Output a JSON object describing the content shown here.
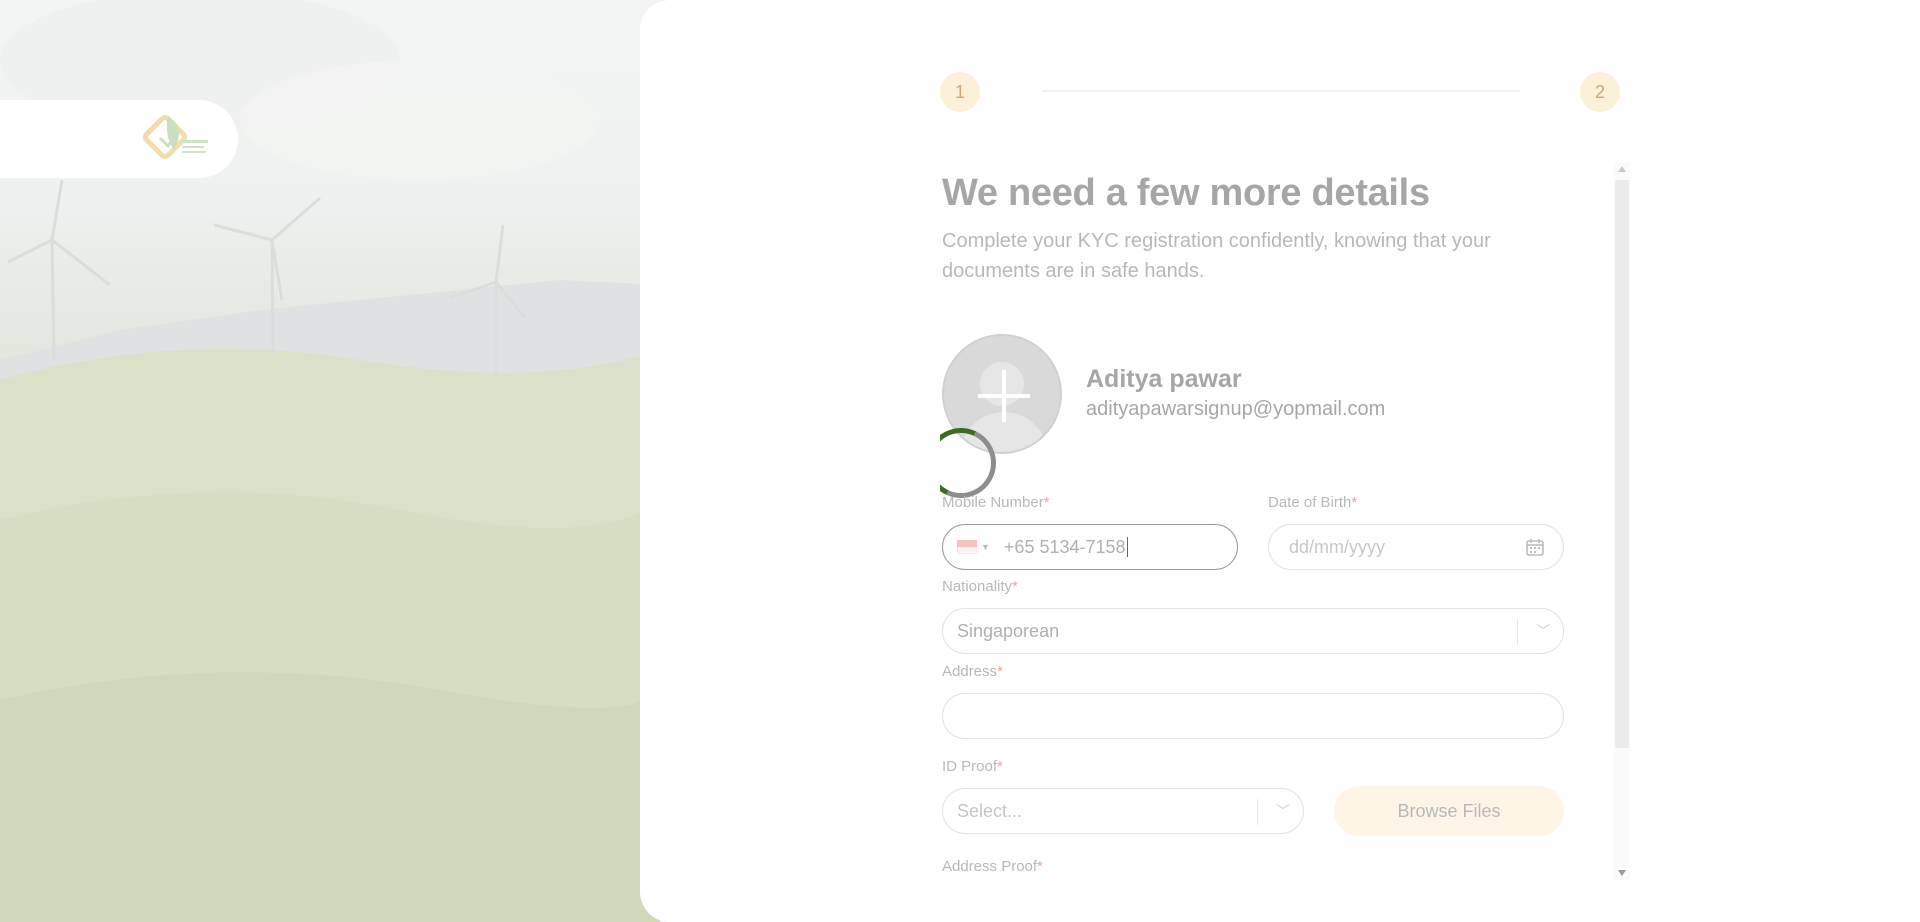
{
  "stepper": {
    "steps": [
      "1",
      "2"
    ]
  },
  "form": {
    "title": "We need a few more details",
    "subtitle": "Complete your KYC registration confidently, knowing that your documents are in safe hands.",
    "user": {
      "name": "Aditya pawar",
      "email": "adityapawarsignup@yopmail.com"
    },
    "required_mark": "*",
    "mobile": {
      "label": "Mobile Number",
      "country_flag": "singapore-flag",
      "value": "+65 5134-7158"
    },
    "dob": {
      "label": "Date of Birth",
      "placeholder": "dd/mm/yyyy"
    },
    "nationality": {
      "label": "Nationality",
      "value": "Singaporean"
    },
    "address": {
      "label": "Address",
      "value": ""
    },
    "id_proof": {
      "label": "ID Proof",
      "placeholder": "Select...",
      "browse_label": "Browse Files"
    },
    "address_proof": {
      "label": "Address Proof"
    }
  },
  "colors": {
    "accent": "#fdf0d8",
    "required": "#f0a0a0",
    "spinner": "#3f6a24"
  }
}
